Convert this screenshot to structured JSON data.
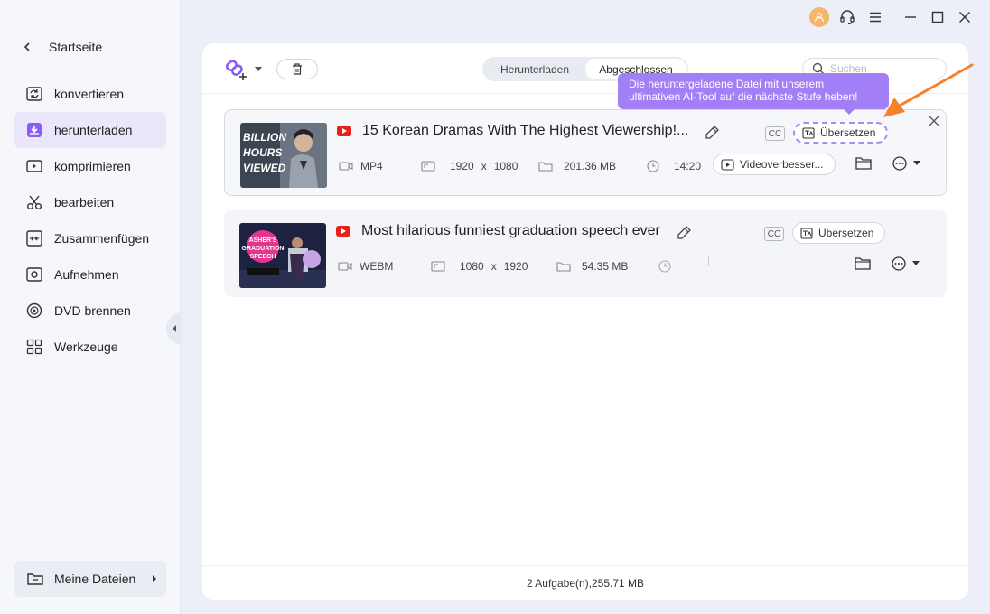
{
  "sidebar": {
    "back_label": "Startseite",
    "items": [
      {
        "label": "konvertieren",
        "icon": "convert-icon"
      },
      {
        "label": "herunterladen",
        "icon": "download-icon",
        "active": true
      },
      {
        "label": "komprimieren",
        "icon": "compress-icon"
      },
      {
        "label": "bearbeiten",
        "icon": "scissors-icon"
      },
      {
        "label": "Zusammenfügen",
        "icon": "merge-icon"
      },
      {
        "label": "Aufnehmen",
        "icon": "record-icon"
      },
      {
        "label": "DVD brennen",
        "icon": "dvd-icon"
      },
      {
        "label": "Werkzeuge",
        "icon": "toolbox-icon"
      }
    ],
    "my_files_label": "Meine Dateien"
  },
  "toolbar": {
    "tabs": [
      {
        "label": "Herunterladen",
        "active": false
      },
      {
        "label": "Abgeschlossen",
        "active": true
      }
    ],
    "search_placeholder": "Suchen"
  },
  "tooltip": {
    "text": "Die heruntergeladene Datei mit unserem ultimativen AI-Tool auf die nächste Stufe heben!"
  },
  "downloads": [
    {
      "title": "15 Korean Dramas With The Highest Viewership!...",
      "format": "MP4",
      "width": "1920",
      "height": "1080",
      "size": "201.36 MB",
      "duration": "14:20",
      "cc": "CC",
      "translate_label": "Übersetzen",
      "enhance_label": "Videoverbesser...",
      "thumb_text": "BILLION HOURS VIEWED"
    },
    {
      "title": "Most hilarious funniest graduation speech ever",
      "format": "WEBM",
      "width": "1080",
      "height": "1920",
      "size": "54.35 MB",
      "duration": "",
      "cc": "CC",
      "translate_label": "Übersetzen",
      "thumb_text": "ASHER'S GRADUATION SPEECH"
    }
  ],
  "dimension_separator": "x",
  "footer": {
    "summary": "2 Aufgabe(n),255.71 MB"
  },
  "colors": {
    "accent": "#8b5cf6",
    "tooltip": "#a27ff7",
    "arrow": "#f5822a",
    "youtube": "#e62117"
  }
}
